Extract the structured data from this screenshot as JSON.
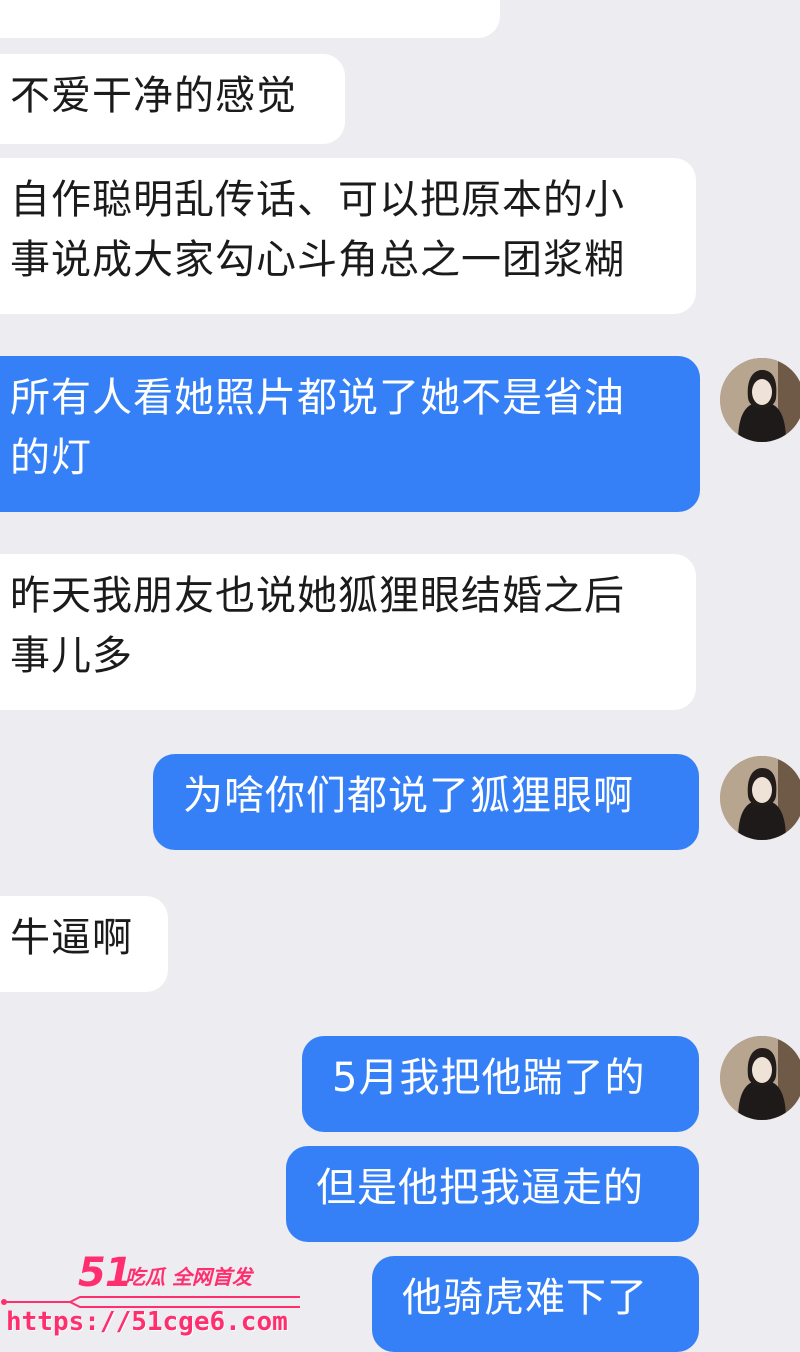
{
  "messages": [
    {
      "side": "in",
      "lines": [
        "不爱干净的感觉"
      ]
    },
    {
      "side": "in",
      "lines": [
        "自作聪明乱传话、可以把原本的小",
        "事说成大家勾心斗角总之一团浆糊"
      ]
    },
    {
      "side": "out",
      "lines": [
        "所有人看她照片都说了她不是省油",
        "的灯"
      ]
    },
    {
      "side": "in",
      "lines": [
        "昨天我朋友也说她狐狸眼结婚之后",
        "事儿多"
      ]
    },
    {
      "side": "out",
      "lines": [
        "为啥你们都说了狐狸眼啊"
      ]
    },
    {
      "side": "in",
      "lines": [
        "牛逼啊"
      ]
    },
    {
      "side": "out",
      "lines": [
        "5月我把他踹了的"
      ]
    },
    {
      "side": "out",
      "lines": [
        "但是他把我逼走的"
      ]
    },
    {
      "side": "out",
      "lines": [
        "他骑虎难下了"
      ]
    }
  ],
  "watermark": {
    "logo": "51",
    "tagline": "吃瓜 全网首发",
    "url": "https://51cge6.com"
  },
  "colors": {
    "background": "#ececf1",
    "incoming_bubble": "#ffffff",
    "outgoing_bubble": "#3680f7",
    "watermark": "#ff2e6e"
  }
}
